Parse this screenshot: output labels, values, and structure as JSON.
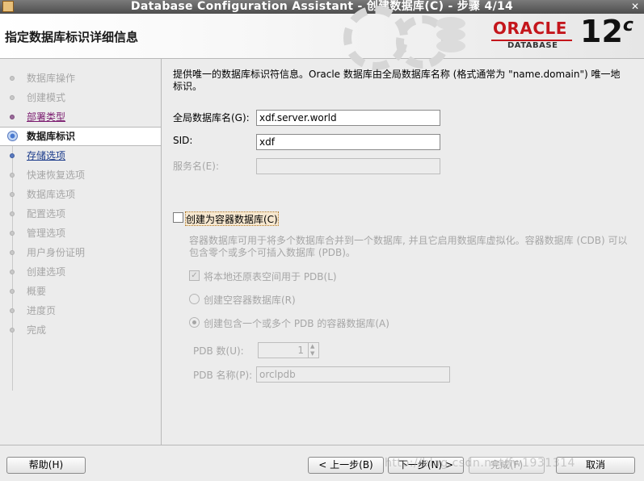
{
  "window": {
    "title": "Database Configuration Assistant - 创建数据库(C) - 步骤 4/14",
    "close_glyph": "✕"
  },
  "banner": {
    "heading": "指定数据库标识详细信息",
    "logo_oracle": "ORACLE",
    "logo_database": "DATABASE",
    "logo_version": "12",
    "logo_version_suffix": "c"
  },
  "steps": [
    {
      "label": "数据库操作",
      "state": "disabled"
    },
    {
      "label": "创建模式",
      "state": "disabled"
    },
    {
      "label": "部署类型",
      "state": "done"
    },
    {
      "label": "数据库标识",
      "state": "current"
    },
    {
      "label": "存储选项",
      "state": "next"
    },
    {
      "label": "快速恢复选项",
      "state": "disabled"
    },
    {
      "label": "数据库选项",
      "state": "disabled"
    },
    {
      "label": "配置选项",
      "state": "disabled"
    },
    {
      "label": "管理选项",
      "state": "disabled"
    },
    {
      "label": "用户身份证明",
      "state": "disabled"
    },
    {
      "label": "创建选项",
      "state": "disabled"
    },
    {
      "label": "概要",
      "state": "disabled"
    },
    {
      "label": "进度页",
      "state": "disabled"
    },
    {
      "label": "完成",
      "state": "disabled"
    }
  ],
  "main": {
    "intro": "提供唯一的数据库标识符信息。Oracle 数据库由全局数据库名称 (格式通常为 \"name.domain\") 唯一地标识。",
    "global_db_name_label": "全局数据库名(G):",
    "global_db_name_value": "xdf.server.world",
    "sid_label": "SID:",
    "sid_value": "xdf",
    "service_name_label": "服务名(E):",
    "service_name_value": "",
    "container_checkbox_label": "创建为容器数据库(C)",
    "container_checked": false,
    "container_desc": "容器数据库可用于将多个数据库合并到一个数据库, 并且它启用数据库虚拟化。容器数据库 (CDB) 可以包含零个或多个可插入数据库 (PDB)。",
    "local_undo_label": "将本地还原表空间用于 PDB(L)",
    "local_undo_checked": true,
    "empty_cdb_label": "创建空容器数据库(R)",
    "pdb_cdb_label": "创建包含一个或多个 PDB 的容器数据库(A)",
    "pdb_count_label": "PDB 数(U):",
    "pdb_count_value": "1",
    "pdb_name_label": "PDB 名称(P):",
    "pdb_name_value": "orclpdb"
  },
  "buttons": {
    "help": "帮助(H)",
    "back": "< 上一步(B)",
    "next": "下一步(N) >",
    "finish": "完成(F)",
    "cancel": "取消"
  },
  "watermark": "http://blog.csdn.net/fw1931314"
}
